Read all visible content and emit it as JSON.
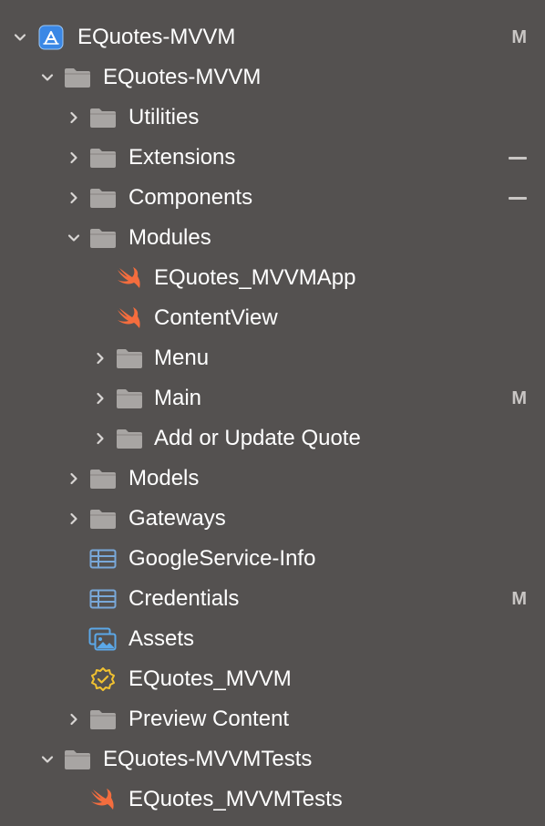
{
  "colors": {
    "background": "#545150",
    "text": "#ffffff",
    "folder": "#a8a5a3",
    "swift": "#f46d3e",
    "project": "#3a87e5",
    "plist": "#79a8d9",
    "assets": "#5ba8e8",
    "entitlements": "#f2c230",
    "status": "#c9c6c4"
  },
  "status_markers": {
    "modified": "M",
    "dash": "—"
  },
  "tree": [
    {
      "label": "EQuotes-MVVM",
      "icon": "xcode-project-icon",
      "disclosure": "expanded",
      "status": "M"
    },
    {
      "label": "EQuotes-MVVM",
      "icon": "folder-icon",
      "disclosure": "expanded",
      "status": ""
    },
    {
      "label": "Utilities",
      "icon": "folder-icon",
      "disclosure": "collapsed",
      "status": ""
    },
    {
      "label": "Extensions",
      "icon": "folder-icon",
      "disclosure": "collapsed",
      "status": "—"
    },
    {
      "label": "Components",
      "icon": "folder-icon",
      "disclosure": "collapsed",
      "status": "—"
    },
    {
      "label": "Modules",
      "icon": "folder-icon",
      "disclosure": "expanded",
      "status": ""
    },
    {
      "label": "EQuotes_MVVMApp",
      "icon": "swift-icon",
      "disclosure": "none",
      "status": ""
    },
    {
      "label": "ContentView",
      "icon": "swift-icon",
      "disclosure": "none",
      "status": ""
    },
    {
      "label": "Menu",
      "icon": "folder-icon",
      "disclosure": "collapsed",
      "status": ""
    },
    {
      "label": "Main",
      "icon": "folder-icon",
      "disclosure": "collapsed",
      "status": "M"
    },
    {
      "label": "Add or Update Quote",
      "icon": "folder-icon",
      "disclosure": "collapsed",
      "status": ""
    },
    {
      "label": "Models",
      "icon": "folder-icon",
      "disclosure": "collapsed",
      "status": ""
    },
    {
      "label": "Gateways",
      "icon": "folder-icon",
      "disclosure": "collapsed",
      "status": ""
    },
    {
      "label": "GoogleService-Info",
      "icon": "plist-icon",
      "disclosure": "none",
      "status": ""
    },
    {
      "label": "Credentials",
      "icon": "plist-icon",
      "disclosure": "none",
      "status": "M"
    },
    {
      "label": "Assets",
      "icon": "asset-catalog-icon",
      "disclosure": "none",
      "status": ""
    },
    {
      "label": "EQuotes_MVVM",
      "icon": "entitlements-icon",
      "disclosure": "none",
      "status": ""
    },
    {
      "label": "Preview Content",
      "icon": "folder-icon",
      "disclosure": "collapsed",
      "status": ""
    },
    {
      "label": "EQuotes-MVVMTests",
      "icon": "folder-icon",
      "disclosure": "expanded",
      "status": ""
    },
    {
      "label": "EQuotes_MVVMTests",
      "icon": "swift-icon",
      "disclosure": "none",
      "status": ""
    }
  ]
}
